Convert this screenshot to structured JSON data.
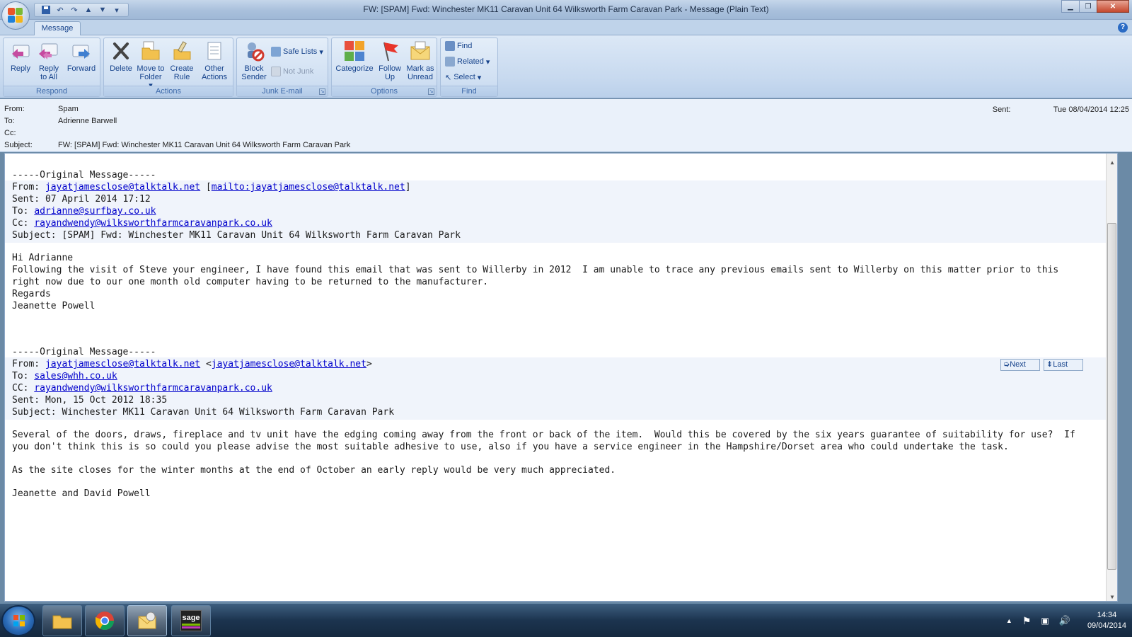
{
  "window": {
    "title": "FW: [SPAM]  Fwd: Winchester MK11 Caravan Unit 64 Wilksworth Farm Caravan Park  -  Message (Plain Text)",
    "controls": [
      "minimize",
      "restore",
      "close"
    ]
  },
  "qat": {
    "icons": [
      "save-icon",
      "undo-icon",
      "redo-icon",
      "up-arrow-icon",
      "down-arrow-icon",
      "customize-icon"
    ]
  },
  "ribbon": {
    "tab": "Message",
    "groups": {
      "respond": {
        "label": "Respond",
        "reply": "Reply",
        "reply_all": "Reply to All",
        "forward": "Forward"
      },
      "actions": {
        "label": "Actions",
        "delete": "Delete",
        "move": "Move to Folder",
        "rule": "Create Rule",
        "other": "Other Actions"
      },
      "junk": {
        "label": "Junk E-mail",
        "block": "Block Sender",
        "safe": "Safe Lists",
        "not_junk": "Not Junk"
      },
      "options": {
        "label": "Options",
        "categorize": "Categorize",
        "follow": "Follow Up",
        "mark": "Mark as Unread"
      },
      "find": {
        "label": "Find",
        "find": "Find",
        "related": "Related",
        "select": "Select"
      }
    }
  },
  "header": {
    "from_label": "From:",
    "from": "Spam",
    "to_label": "To:",
    "to": "Adrienne Barwell",
    "cc_label": "Cc:",
    "cc": "",
    "subject_label": "Subject:",
    "subject": "FW: [SPAM]  Fwd: Winchester MK11 Caravan Unit 64 Wilksworth Farm Caravan Park",
    "sent_label": "Sent:",
    "sent": "Tue 08/04/2014 12:25"
  },
  "body": {
    "orig1_title": "-----Original Message-----",
    "orig1_from_label": "From: ",
    "orig1_from_email": "jayatjamesclose@talktalk.net",
    "orig1_from_open": " [",
    "orig1_from_mailto": "mailto:jayatjamesclose@talktalk.net",
    "orig1_from_close": "]",
    "orig1_sent": "Sent: 07 April 2014 17:12",
    "orig1_to_label": "To: ",
    "orig1_to_email": "adrianne@surfbay.co.uk",
    "orig1_cc_label": "Cc: ",
    "orig1_cc_email": "rayandwendy@wilksworthfarmcaravanpark.co.uk",
    "orig1_subject": "Subject: [SPAM] Fwd: Winchester MK11 Caravan Unit 64 Wilksworth Farm Caravan Park",
    "greeting": "Hi Adrianne",
    "para1_line1": "Following the visit of Steve your engineer, I have found this email that was sent to Willerby in 2012  I am unable to trace any previous emails sent to Willerby on this matter prior to this",
    "para1_line2": "right now due to our one month old computer having to be returned to the manufacturer.",
    "regards": "Regards",
    "signature1": "Jeanette Powell",
    "orig2_title": "-----Original Message-----",
    "orig2_from_label": "From: ",
    "orig2_from_email": "jayatjamesclose@talktalk.net",
    "orig2_from_open": " <",
    "orig2_from_email2": "jayatjamesclose@talktalk.net",
    "orig2_from_close": ">",
    "orig2_to_label": "To: ",
    "orig2_to_email": "sales@whh.co.uk",
    "orig2_cc_label": "CC: ",
    "orig2_cc_email": "rayandwendy@wilksworthfarmcaravanpark.co.uk",
    "orig2_sent": "Sent: Mon, 15 Oct 2012 18:35",
    "orig2_subject": "Subject: Winchester MK11 Caravan Unit 64 Wilksworth Farm Caravan Park",
    "para2_line1": "Several of the doors, draws, fireplace and tv unit have the edging coming away from the front or back of the item.  Would this be covered by the six years guarantee of suitability for use?  If",
    "para2_line2": "you don't think this is so could you please advise the most suitable adhesive to use, also if you have a service engineer in the Hampshire/Dorset area who could undertake the task.",
    "para3": "As the site closes for the winter months at the end of October an early reply would be very much appreciated.",
    "signature2": "Jeanette and David Powell",
    "nav_next": "Next",
    "nav_last": "Last"
  },
  "taskbar": {
    "apps": [
      "windows-explorer",
      "chrome",
      "outlook",
      "sage"
    ],
    "sage_label": "sage",
    "time": "14:34",
    "date": "09/04/2014"
  },
  "colors": {
    "link": "#0000cc",
    "ribbon_text": "#15428b",
    "group_label": "#3e6aaa"
  }
}
